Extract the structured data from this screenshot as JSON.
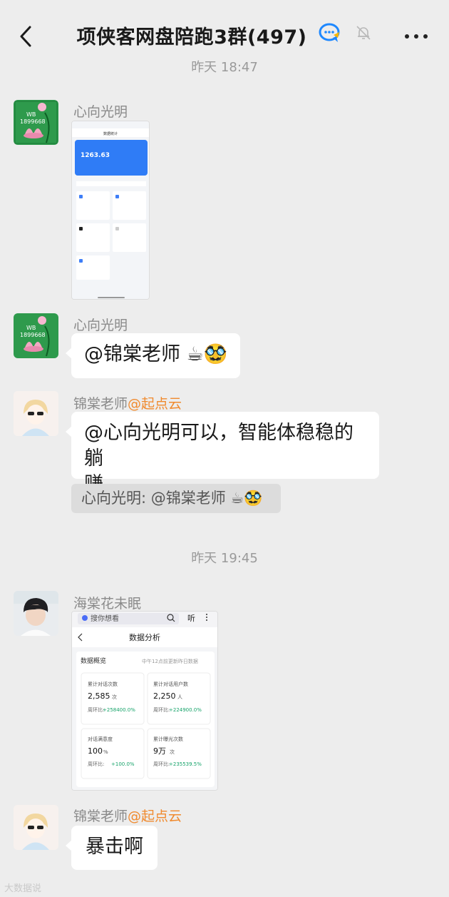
{
  "header": {
    "title": "项侠客网盘陪跑3群(497)",
    "back_icon": "chevron-left-icon",
    "more_icon": "more-horizontal-icon",
    "mute_icon": "bell-off-icon",
    "group_icon": "ai-chat-icon"
  },
  "timestamps": [
    "昨天 18:47",
    "昨天 19:45"
  ],
  "messages": [
    {
      "sender": "心向光明",
      "type": "image",
      "avatar_text_1": "WB",
      "avatar_text_2": "1899668"
    },
    {
      "sender": "心向光明",
      "type": "text",
      "text": "@锦棠老师 ☕🥸",
      "avatar_text_1": "WB",
      "avatar_text_2": "1899668"
    },
    {
      "sender": "锦棠老师",
      "sender_tag": "@起点云",
      "type": "text",
      "text_line1": "@心向光明可以，智能体稳稳的躺",
      "text_line2": "赚",
      "quote": "心向光明: @锦棠老师 ☕🥸"
    },
    {
      "sender": "海棠花未眠",
      "type": "image"
    },
    {
      "sender": "锦棠老师",
      "sender_tag": "@起点云",
      "type": "text",
      "text": "暴击啊"
    }
  ],
  "shot1": {
    "app_title": "数据统计",
    "balance": "1263.63"
  },
  "shot2": {
    "search_placeholder": "搜你想看",
    "listen": "听",
    "page_title": "数据分析",
    "section_title": "数据概览",
    "section_note": "中午12点前更新昨日数据",
    "cards": [
      {
        "label": "累计对话次数",
        "value": "2,585",
        "unit": "次",
        "change_label": "周环比:",
        "change": "+258400.0%"
      },
      {
        "label": "累计对话用户数",
        "value": "2,250",
        "unit": "人",
        "change_label": "周环比:",
        "change": "+224900.0%"
      },
      {
        "label": "对话满意度",
        "value": "100",
        "unit": "%",
        "change_label": "周环比:",
        "change": "+100.0%"
      },
      {
        "label": "累计曝光次数",
        "value": "9万",
        "unit": "次",
        "change_label": "周环比:",
        "change": "+235539.5%"
      }
    ]
  },
  "watermark": "大数据说"
}
